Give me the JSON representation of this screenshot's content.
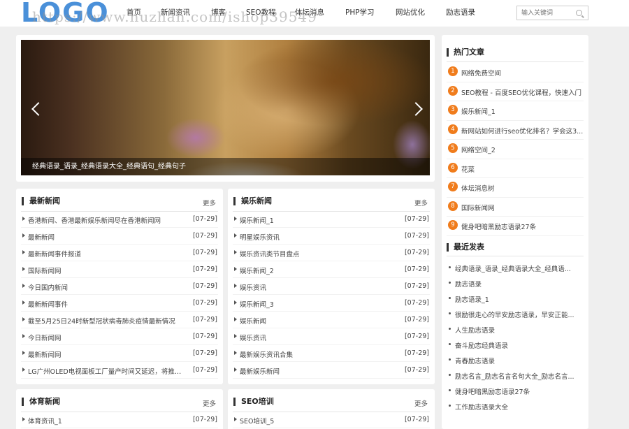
{
  "header": {
    "logo": "LOGO",
    "watermark": "https://www.huzhan.com/ishop39549",
    "nav": [
      "首页",
      "新闻资讯",
      "博客",
      "SEO教程",
      "体坛消息",
      "PHP学习",
      "网站优化",
      "励志语录"
    ],
    "search_placeholder": "输入关键词"
  },
  "slider": {
    "caption": "经典语录_语录_经典语录大全_经典语句_经典句子"
  },
  "panels": {
    "latest": {
      "title": "最新新闻",
      "more": "更多",
      "items": [
        {
          "t": "香港新闻、香港最新娱乐新闻尽在香港新闻网",
          "d": "[07-29]"
        },
        {
          "t": "最新新闻",
          "d": "[07-29]"
        },
        {
          "t": "最新新闻事件报道",
          "d": "[07-29]"
        },
        {
          "t": "国际新闻网",
          "d": "[07-29]"
        },
        {
          "t": "今日国内新闻",
          "d": "[07-29]"
        },
        {
          "t": "最新新闻事件",
          "d": "[07-29]"
        },
        {
          "t": "截至5月25日24时新型冠状病毒肺炎疫情最新情况",
          "d": "[07-29]"
        },
        {
          "t": "今日新闻网",
          "d": "[07-29]"
        },
        {
          "t": "最新新闻网",
          "d": "[07-29]"
        },
        {
          "t": "LG广州OLED电视面板工厂量产时间又延迟，将推迟...",
          "d": "[07-29]"
        }
      ]
    },
    "ent": {
      "title": "娱乐新闻",
      "more": "更多",
      "items": [
        {
          "t": "娱乐新闻_1",
          "d": "[07-29]"
        },
        {
          "t": "明星娱乐资讯",
          "d": "[07-29]"
        },
        {
          "t": "娱乐资讯类节目盘点",
          "d": "[07-29]"
        },
        {
          "t": "娱乐新闻_2",
          "d": "[07-29]"
        },
        {
          "t": "娱乐资讯",
          "d": "[07-29]"
        },
        {
          "t": "娱乐新闻_3",
          "d": "[07-29]"
        },
        {
          "t": "娱乐新闻",
          "d": "[07-29]"
        },
        {
          "t": "娱乐资讯",
          "d": "[07-29]"
        },
        {
          "t": "最新娱乐资讯合集",
          "d": "[07-29]"
        },
        {
          "t": "最新娱乐新闻",
          "d": "[07-29]"
        }
      ]
    },
    "sport": {
      "title": "体育新闻",
      "more": "更多",
      "items": [
        {
          "t": "体育资讯_1",
          "d": "[07-29]"
        }
      ]
    },
    "seo": {
      "title": "SEO培训",
      "more": "更多",
      "items": [
        {
          "t": "SEO培训_5",
          "d": "[07-29]"
        }
      ]
    }
  },
  "sidebar": {
    "hot_title": "热门文章",
    "hot": [
      {
        "n": "1",
        "t": "网络免费空间"
      },
      {
        "n": "2",
        "t": "SEO教程 - 百度SEO优化课程，快速入门"
      },
      {
        "n": "3",
        "t": "娱乐新闻_1"
      },
      {
        "n": "4",
        "t": "新网站如何进行seo优化排名？学会这3..."
      },
      {
        "n": "5",
        "t": "网络空间_2"
      },
      {
        "n": "6",
        "t": "花菜"
      },
      {
        "n": "7",
        "t": "体坛消息树"
      },
      {
        "n": "8",
        "t": "国际新闻网"
      },
      {
        "n": "9",
        "t": "健身吧暗黑励志语录27条"
      }
    ],
    "recent_title": "最近发表",
    "recent": [
      "经典语录_语录_经典语录大全_经典语...",
      "励志语录",
      "励志语录_1",
      "很励很走心的早安励志语录，早安正能...",
      "人生励志语录",
      "奋斗励志经典语录",
      "青春励志语录",
      "励志名言_励志名言名句大全_励志名言...",
      "健身吧暗黑励志语录27条",
      "工作励志语录大全"
    ]
  }
}
